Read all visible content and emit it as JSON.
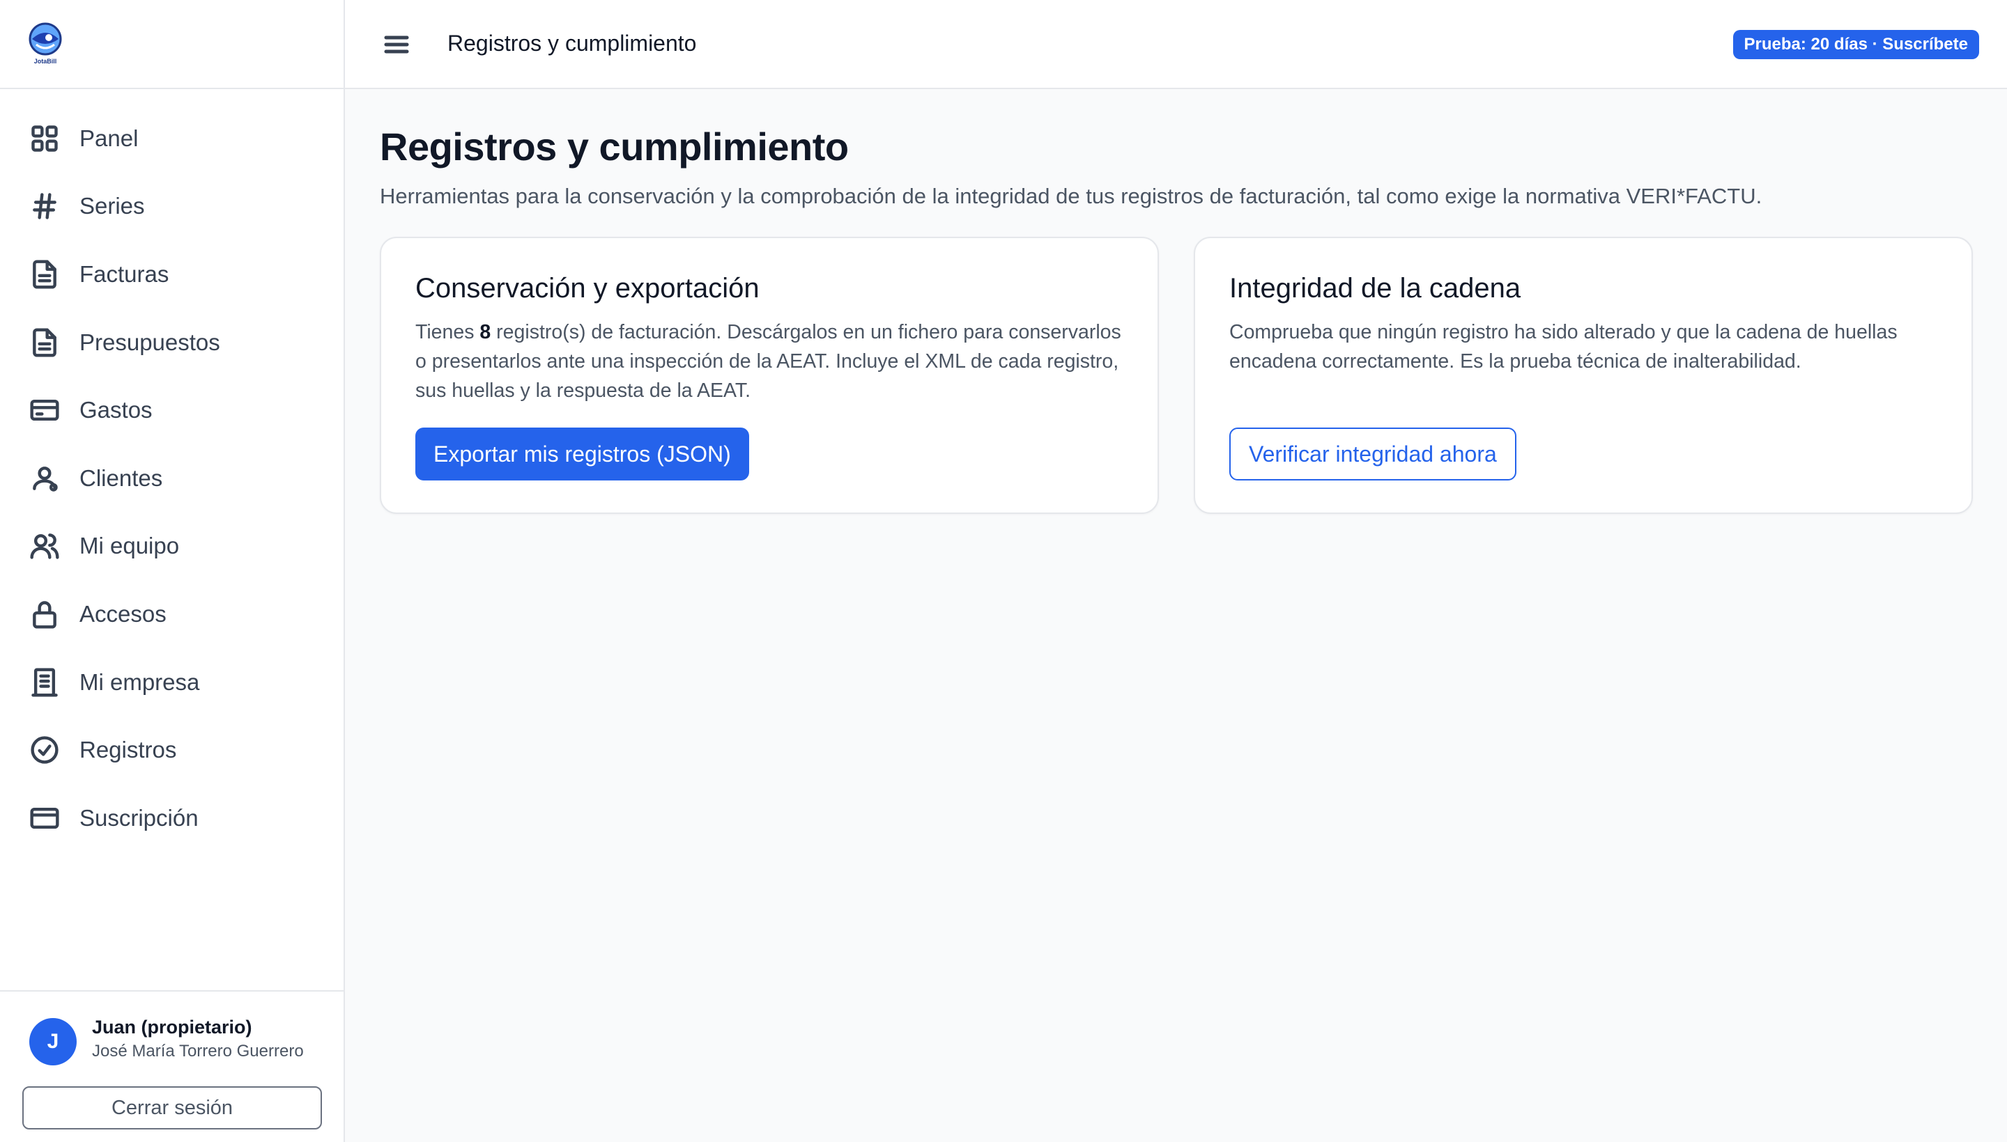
{
  "app": {
    "logo_text": "JotaBill"
  },
  "sidebar": {
    "items": [
      {
        "label": "Panel",
        "icon": "grid-icon"
      },
      {
        "label": "Series",
        "icon": "hash-icon"
      },
      {
        "label": "Facturas",
        "icon": "document-icon"
      },
      {
        "label": "Presupuestos",
        "icon": "document-icon"
      },
      {
        "label": "Gastos",
        "icon": "receipt-card-icon"
      },
      {
        "label": "Clientes",
        "icon": "clients-icon"
      },
      {
        "label": "Mi equipo",
        "icon": "users-icon"
      },
      {
        "label": "Accesos",
        "icon": "lock-icon"
      },
      {
        "label": "Mi empresa",
        "icon": "building-icon"
      },
      {
        "label": "Registros",
        "icon": "check-circle-icon"
      },
      {
        "label": "Suscripción",
        "icon": "credit-card-icon"
      }
    ],
    "user": {
      "initial": "J",
      "name": "Juan (propietario)",
      "company": "José María Torrero Guerrero",
      "logout_label": "Cerrar sesión"
    }
  },
  "header": {
    "title": "Registros y cumplimiento",
    "trial_badge": "Prueba: 20 días · Suscríbete"
  },
  "main": {
    "title": "Registros y cumplimiento",
    "subtitle": "Herramientas para la conservación y la comprobación de la integridad de tus registros de facturación, tal como exige la normativa VERI*FACTU.",
    "export_card": {
      "title": "Conservación y exportación",
      "text_before": "Tienes ",
      "record_count": "8",
      "text_after": " registro(s) de facturación. Descárgalos en un fichero para conservarlos o presentarlos ante una inspección de la AEAT. Incluye el XML de cada registro, sus huellas y la respuesta de la AEAT.",
      "button_label": "Exportar mis registros (JSON)"
    },
    "integrity_card": {
      "title": "Integridad de la cadena",
      "text": "Comprueba que ningún registro ha sido alterado y que la cadena de huellas encadena correctamente. Es la prueba técnica de inalterabilidad.",
      "button_label": "Verificar integridad ahora"
    }
  },
  "colors": {
    "accent": "#2563eb",
    "text_primary": "#111827",
    "text_secondary": "#4b5563",
    "border": "#e5e7eb",
    "background": "#f9fafb"
  }
}
